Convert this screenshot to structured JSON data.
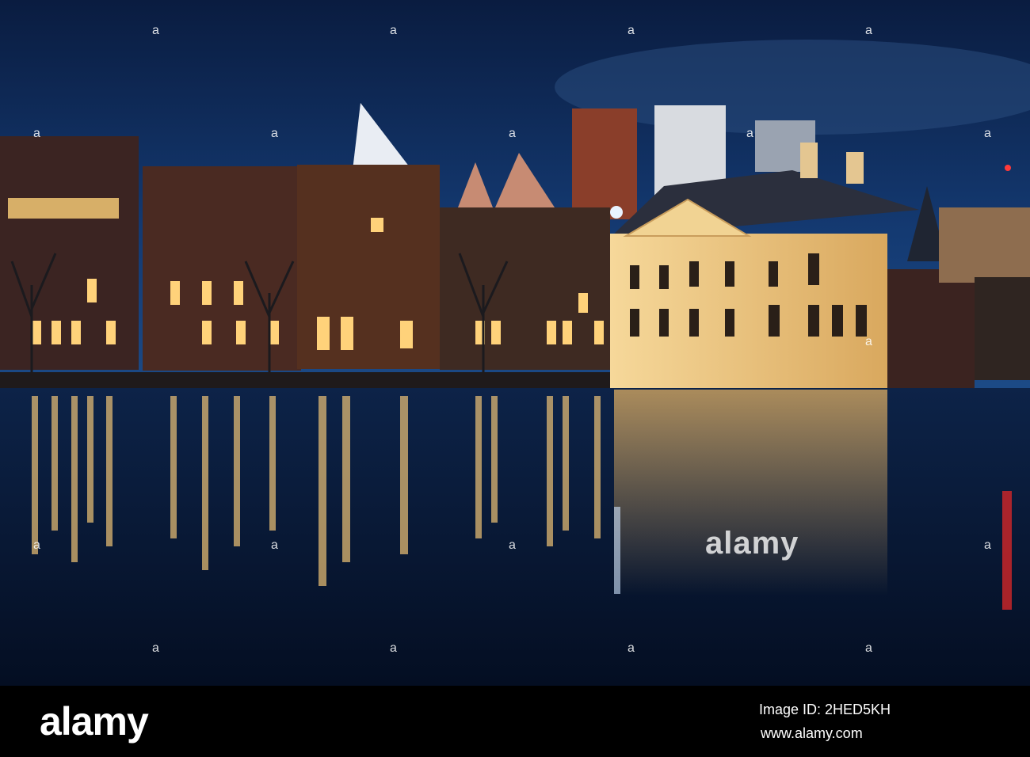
{
  "photo": {
    "subject": "Night view of Mauritshuis museum and Hofvijver pond with reflections, The Hague skyline",
    "colors": {
      "sky_top": "#0b1f45",
      "sky_bottom": "#17417a",
      "water": "#06152f",
      "museum_glow": "#f3cf8a",
      "window_light": "#ffd27a"
    }
  },
  "watermark": {
    "center_text": "alamy",
    "small_marks": [
      "a",
      "a",
      "a",
      "a",
      "a",
      "a",
      "a",
      "a",
      "a",
      "a",
      "a",
      "a",
      "a",
      "a",
      "a",
      "a",
      "a",
      "a"
    ]
  },
  "footer": {
    "logo": "alamy",
    "image_id": "Image ID: 2HED5KH",
    "url": "www.alamy.com"
  }
}
